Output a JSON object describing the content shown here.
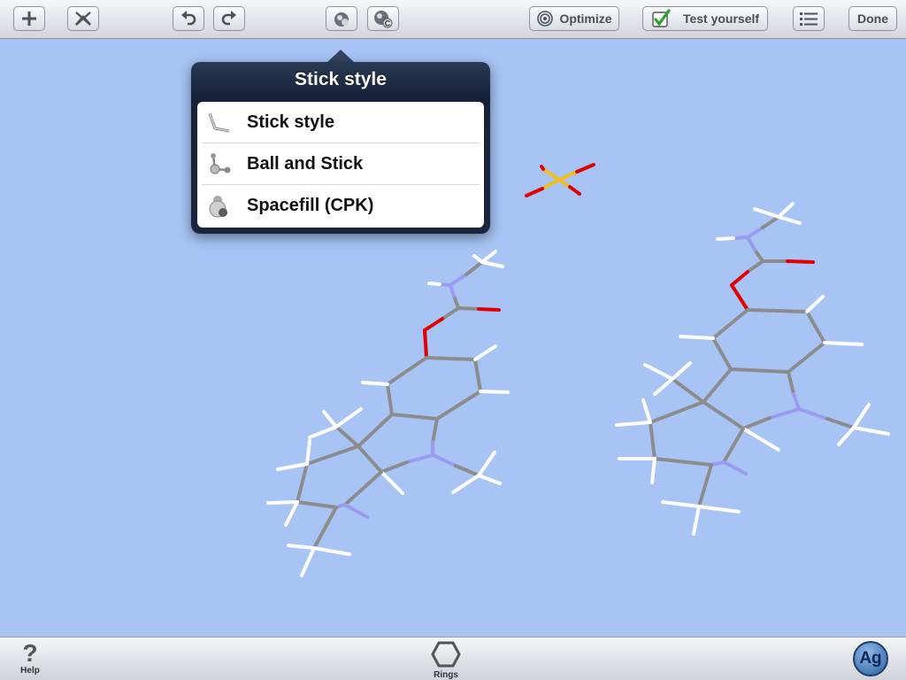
{
  "toolbar": {
    "add_icon": "plus-icon",
    "clear_icon": "clear-icon",
    "undo_icon": "undo-icon",
    "redo_icon": "redo-icon",
    "style_icon": "atom-style-icon",
    "carbon_icon": "carbon-label-icon",
    "carbon_glyph": "C",
    "optimize_label": "Optimize",
    "test_label": "Test yourself",
    "list_icon": "list-icon",
    "done_label": "Done"
  },
  "popover": {
    "title": "Stick style",
    "items": [
      {
        "label": "Stick style",
        "icon": "stick-style-icon"
      },
      {
        "label": "Ball and Stick",
        "icon": "ball-and-stick-icon"
      },
      {
        "label": "Spacefill (CPK)",
        "icon": "spacefill-icon"
      }
    ]
  },
  "bottombar": {
    "help_glyph": "?",
    "help_label": "Help",
    "rings_label": "Rings",
    "ag_label": "Ag"
  },
  "colors": {
    "background": "#a7c4f5",
    "carbon": "#8c8c8c",
    "hydrogen": "#ffffff",
    "nitrogen": "#9a9af0",
    "oxygen": "#e00000",
    "sulfur": "#f0c020"
  }
}
